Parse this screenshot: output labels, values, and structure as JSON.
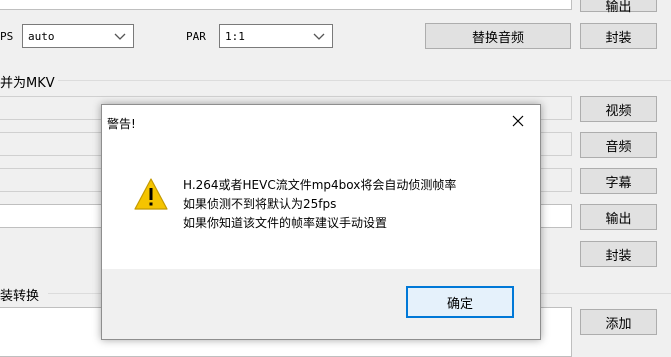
{
  "toolbar_row": {
    "fps_label_partial": "PS",
    "fps_value": "auto",
    "par_label": "PAR",
    "par_value": "1:1",
    "replace_audio_button": "替换音频",
    "mux_button": "封装",
    "output_button_partial": "输出"
  },
  "merge_section": {
    "title_partial": "并为MKV",
    "video_button": "视频",
    "audio_button": "音频",
    "subtitle_button": "字幕",
    "output_button": "输出",
    "mux_button": "封装"
  },
  "convert_section": {
    "title_partial": "装转换",
    "add_button": "添加"
  },
  "dialog": {
    "title": "警告!",
    "icon": "warning-icon",
    "message_lines": [
      "H.264或者HEVC流文件mp4box将会自动侦测帧率",
      "如果侦测不到将默认为25fps",
      "如果你知道该文件的帧率建议手动设置"
    ],
    "ok_button": "确定"
  }
}
